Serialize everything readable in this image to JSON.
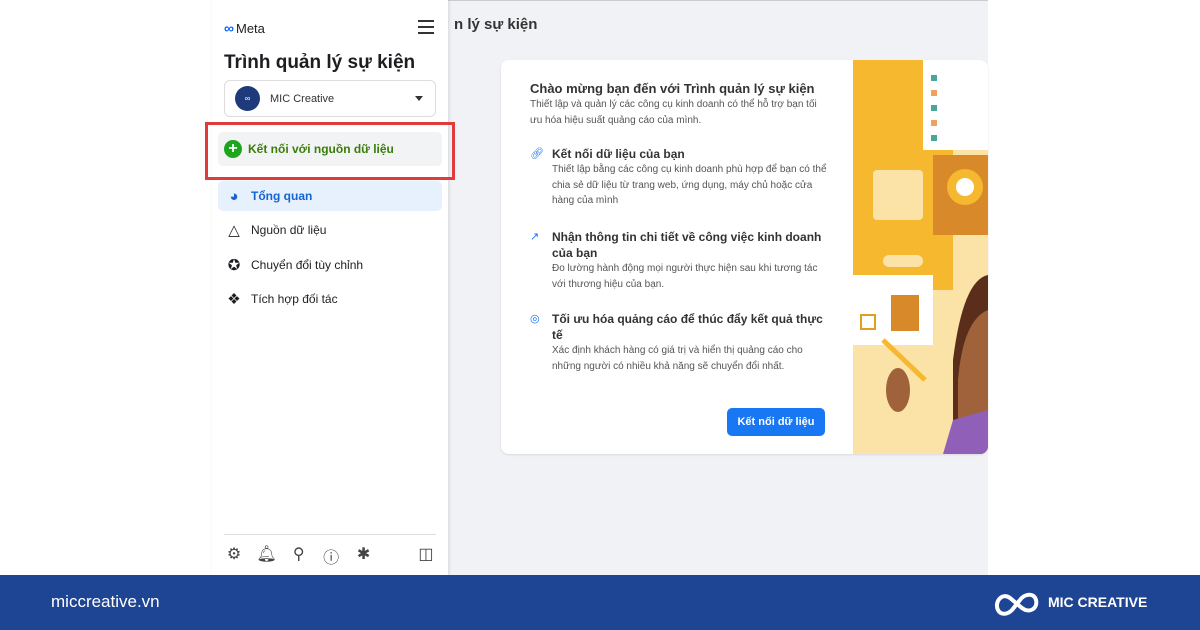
{
  "sidebar": {
    "logo": "Meta",
    "title": "Trình quản lý sự kiện",
    "account": "MIC Creative",
    "connect_label": "Kết nối với nguồn dữ liệu",
    "items": [
      {
        "label": "Tổng quan",
        "icon": "gauge-icon",
        "active": true
      },
      {
        "label": "Nguồn dữ liệu",
        "icon": "network-icon"
      },
      {
        "label": "Chuyển đổi tùy chỉnh",
        "icon": "star-circle-icon"
      },
      {
        "label": "Tích hợp đối tác",
        "icon": "handshake-icon"
      }
    ],
    "bottom_icons": [
      "gear-icon",
      "bell-icon",
      "search-icon",
      "help-icon",
      "bug-icon",
      "panel-toggle-icon"
    ]
  },
  "header": {
    "title": "n lý sự kiện"
  },
  "card": {
    "title": "Chào mừng bạn đến với Trình quản lý sự kiện",
    "subtitle": "Thiết lập và quản lý các công cụ kinh doanh có thể hỗ trợ bạn tối ưu hóa hiệu suất quảng cáo của mình.",
    "features": [
      {
        "icon": "link-icon",
        "heading": "Kết nối dữ liệu của bạn",
        "desc": "Thiết lập bằng các công cụ kinh doanh phù hợp để bạn có thể chia sẻ dữ liệu từ trang web, ứng dụng, máy chủ hoặc cửa hàng của mình"
      },
      {
        "icon": "trend-icon",
        "heading": "Nhận thông tin chi tiết về công việc kinh doanh của bạn",
        "desc": "Đo lường hành động mọi người thực hiện sau khi tương tác với thương hiệu của bạn."
      },
      {
        "icon": "target-icon",
        "heading": "Tối ưu hóa quảng cáo để thúc đẩy kết quả thực tế",
        "desc": "Xác định khách hàng có giá trị và hiển thị quảng cáo cho những người có nhiều khả năng sẽ chuyển đổi nhất."
      }
    ],
    "button": "Kết nối dữ liệu"
  },
  "footer": {
    "site": "miccreative.vn",
    "brand": "MIC CREATIVE"
  },
  "colors": {
    "accent": "#1877f2",
    "footer": "#1e4594",
    "highlight": "#e03b3b",
    "connect": "#1ea51e"
  }
}
